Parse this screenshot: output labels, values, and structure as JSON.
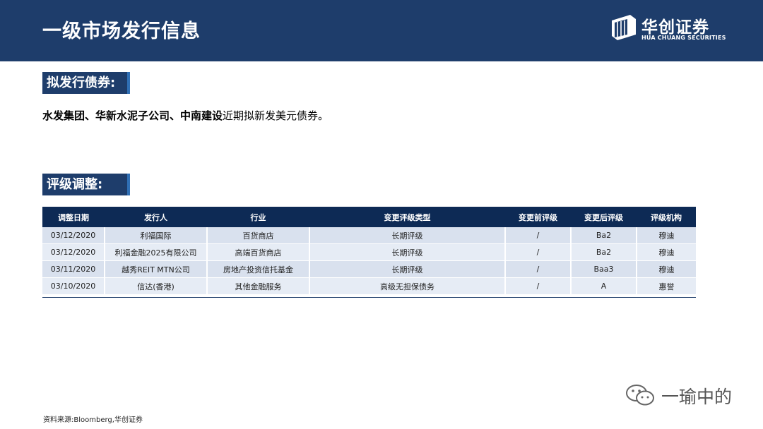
{
  "header": {
    "title": "一级市场发行信息",
    "logo_cn": "华创证券",
    "logo_en": "HUA CHUANG SECURITIES"
  },
  "section1": {
    "tag": "拟发行债券:",
    "issuers_bold": "水发集团、华新水泥子公司、中南建设",
    "suffix": "近期拟新发美元债券。"
  },
  "section2": {
    "tag": "评级调整:"
  },
  "table": {
    "headers": [
      "调整日期",
      "发行人",
      "行业",
      "变更评级类型",
      "变更前评级",
      "变更后评级",
      "评级机构"
    ],
    "rows": [
      [
        "03/12/2020",
        "利福国际",
        "百货商店",
        "长期评级",
        "/",
        "Ba2",
        "穆迪"
      ],
      [
        "03/12/2020",
        "利福金融2025有限公司",
        "高端百货商店",
        "长期评级",
        "/",
        "Ba2",
        "穆迪"
      ],
      [
        "03/11/2020",
        "越秀REIT MTN公司",
        "房地产投资信托基金",
        "长期评级",
        "/",
        "Baa3",
        "穆迪"
      ],
      [
        "03/10/2020",
        "信达(香港)",
        "其他金融服务",
        "高级无担保债务",
        "/",
        "A",
        "惠誉"
      ]
    ]
  },
  "watermark": "一瑜中的",
  "source": "资料来源:Bloomberg,华创证券"
}
